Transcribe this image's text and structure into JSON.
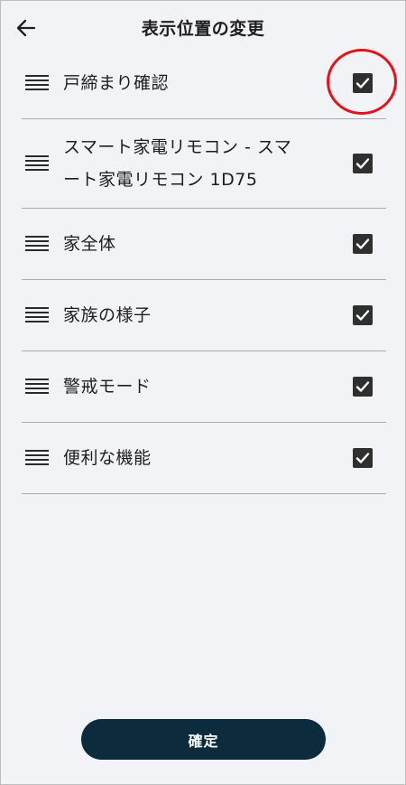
{
  "header": {
    "title": "表示位置の変更",
    "back_icon": "arrow-left-icon"
  },
  "items": [
    {
      "label": "戸締まり確認",
      "checked": true
    },
    {
      "label": "スマート家電リモコン - スマート家電リモコン 1D75",
      "checked": true
    },
    {
      "label": "家全体",
      "checked": true
    },
    {
      "label": "家族の様子",
      "checked": true
    },
    {
      "label": "警戒モード",
      "checked": true
    },
    {
      "label": "便利な機能",
      "checked": true
    }
  ],
  "footer": {
    "confirm_label": "確定"
  },
  "colors": {
    "background": "#f2f3f7",
    "button": "#0c2c3d",
    "checkbox": "#2f2f2f",
    "highlight": "#e8111b"
  }
}
